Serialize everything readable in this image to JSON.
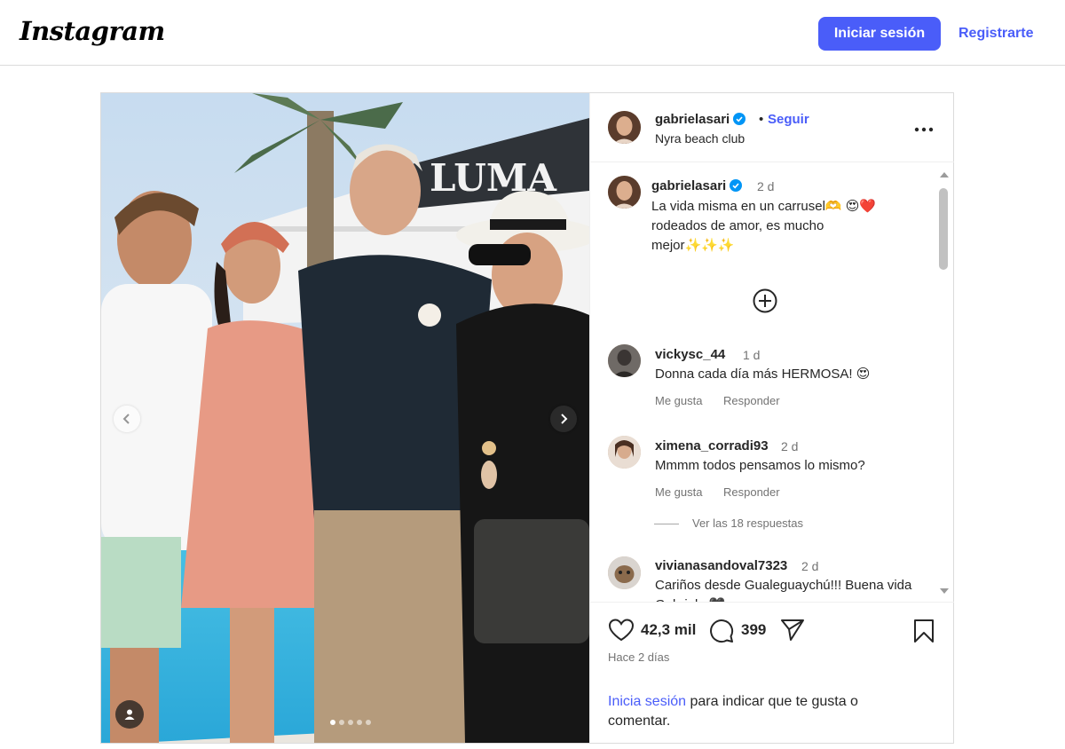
{
  "header": {
    "logo_text": "Instagram",
    "login_label": "Iniciar sesión",
    "register_label": "Registrarte"
  },
  "post": {
    "username": "gabrielasari",
    "separator": "•",
    "follow_label": "Seguir",
    "location": "Nyra beach club",
    "more_icon": "more-horizontal-icon",
    "image_sign_text": "LUMA",
    "carousel_dots": 5,
    "carousel_active_index": 0,
    "caption": {
      "username": "gabrielasari",
      "time": "2 d",
      "text": "La vida misma en un carrusel🫶 😍❤️ rodeados de amor, es mucho mejor✨✨✨"
    },
    "comments": [
      {
        "username": "vickysc_44",
        "time": "1 d",
        "text": "Donna cada día más HERMOSA! 😍",
        "like_label": "Me gusta",
        "reply_label": "Responder"
      },
      {
        "username": "ximena_corradi93",
        "time": "2 d",
        "text": "Mmmm todos pensamos lo mismo?",
        "like_label": "Me gusta",
        "reply_label": "Responder",
        "view_replies_label": "Ver las 18 respuestas"
      },
      {
        "username": "vivianasandoval7323",
        "time": "2 d",
        "text": "Cariños desde Gualeguaychú!!! Buena vida Gabriela 🖤"
      }
    ],
    "likes": "42,3 mil",
    "comment_count": "399",
    "time_ago": "Hace 2 días",
    "footer": {
      "login_link": "Inicia sesión",
      "rest": " para indicar que te gusta o comentar."
    }
  },
  "colors": {
    "accent": "#4a5df9",
    "verified": "#0095f6",
    "muted": "#737373",
    "border": "#dbdbdb"
  }
}
